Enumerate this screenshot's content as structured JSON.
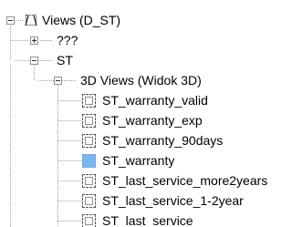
{
  "tree": {
    "root": {
      "label": "Views (D_ST)",
      "icon": "views-root-icon",
      "expanded": true
    },
    "children": [
      {
        "label": "???",
        "expanded": false
      },
      {
        "label": "ST",
        "expanded": true,
        "children": [
          {
            "label": "3D Views (Widok 3D)",
            "expanded": true,
            "views": [
              {
                "label": "ST_warranty_valid",
                "active": false
              },
              {
                "label": "ST_warranty_exp",
                "active": false
              },
              {
                "label": "ST_warranty_90days",
                "active": false
              },
              {
                "label": "ST_warranty",
                "active": true
              },
              {
                "label": "ST_last_service_more2years",
                "active": false
              },
              {
                "label": "ST_last_service_1-2year",
                "active": false
              },
              {
                "label": "ST_last_service",
                "active": false
              }
            ]
          }
        ]
      }
    ]
  },
  "colors": {
    "tree_line": "#a0a0a0",
    "active_view": "#7cb6ec",
    "text": "#000000"
  }
}
